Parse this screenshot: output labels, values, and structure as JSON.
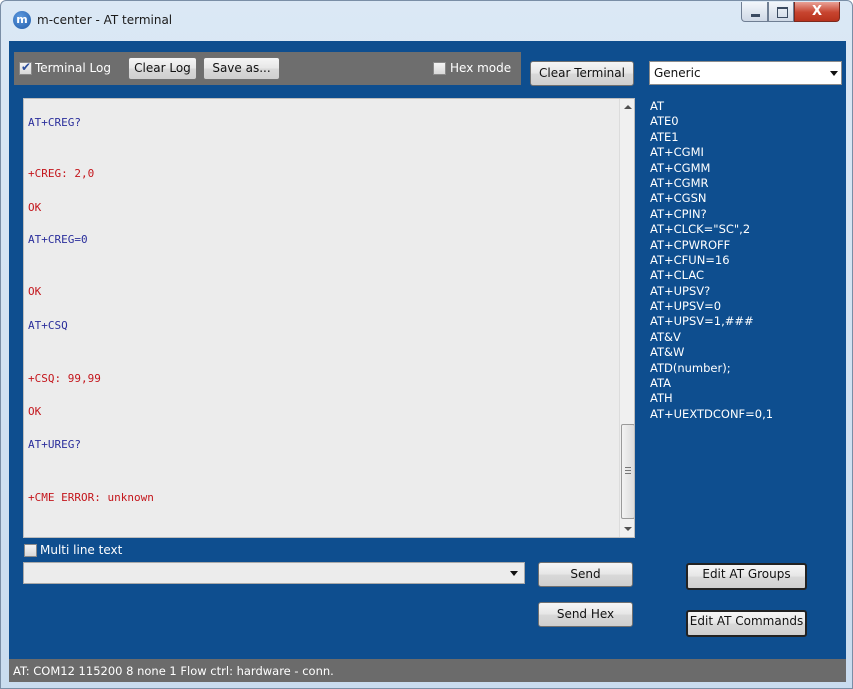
{
  "window": {
    "app_icon_letter": "m",
    "title": "m-center - AT terminal",
    "close_glyph": "X"
  },
  "toolbar": {
    "terminal_log_checked": true,
    "terminal_log_label": "Terminal Log",
    "clear_log_label": "Clear Log",
    "save_as_label": "Save as...",
    "hex_mode_checked": false,
    "hex_mode_label": "Hex mode",
    "clear_terminal_label": "Clear Terminal"
  },
  "profile_combo": {
    "selected": "Generic"
  },
  "log": {
    "lines": [
      {
        "text": "AT+CREG?",
        "color": "#2b2f9c"
      },
      {
        "text": "+CREG: 2,0",
        "color": "#c4161c"
      },
      {
        "text": "OK",
        "color": "#c4161c"
      },
      {
        "text": "AT+CREG=0",
        "color": "#2b2f9c"
      },
      {
        "text": "OK",
        "color": "#c4161c"
      },
      {
        "text": "AT+CSQ",
        "color": "#2b2f9c"
      },
      {
        "text": "+CSQ: 99,99",
        "color": "#c4161c"
      },
      {
        "text": "OK",
        "color": "#c4161c"
      },
      {
        "text": "AT+UREG?",
        "color": "#2b2f9c"
      },
      {
        "text": "+CME ERROR: unknown",
        "color": "#c4161c"
      }
    ]
  },
  "commands": [
    "AT",
    "ATE0",
    "ATE1",
    "AT+CGMI",
    "AT+CGMM",
    "AT+CGMR",
    "AT+CGSN",
    "AT+CPIN?",
    "AT+CLCK=\"SC\",2",
    "AT+CPWROFF",
    "AT+CFUN=16",
    "AT+CLAC",
    "AT+UPSV?",
    "AT+UPSV=0",
    "AT+UPSV=1,###",
    "AT&V",
    "AT&W",
    "ATD(number);",
    "ATA",
    "ATH",
    "AT+UEXTDCONF=0,1"
  ],
  "multiline": {
    "checked": false,
    "label": "Multi line text"
  },
  "input": {
    "value": ""
  },
  "buttons": {
    "send": "Send",
    "send_hex": "Send Hex",
    "edit_groups": "Edit AT Groups",
    "edit_commands": "Edit AT Commands"
  },
  "status": {
    "text": "AT: COM12 115200 8 none 1 Flow ctrl: hardware - conn."
  },
  "colors": {
    "client_background": "#0e4e8f",
    "command_sent": "#2b2f9c",
    "response": "#c4161c"
  }
}
